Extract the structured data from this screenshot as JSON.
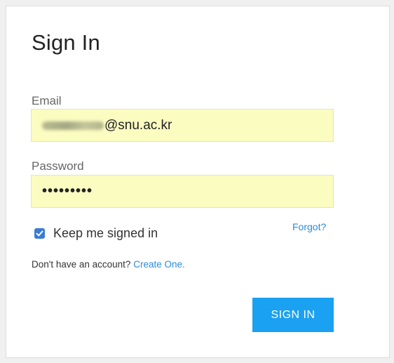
{
  "signin": {
    "title": "Sign In",
    "email_label": "Email",
    "email_value_visible": "@snu.ac.kr",
    "password_label": "Password",
    "password_value": "•••••••••",
    "remember_label": "Keep me signed in",
    "remember_checked": true,
    "forgot_label": "Forgot?",
    "no_account_text": "Don't have an account?",
    "create_link": "Create One.",
    "submit_label": "SIGN IN"
  },
  "colors": {
    "field_bg": "#fafcc0",
    "link": "#2a8cd8",
    "button_bg": "#1ba1f1",
    "checkbox": "#3a7bd5"
  },
  "icons": {
    "checkbox": "checkmark-icon"
  }
}
